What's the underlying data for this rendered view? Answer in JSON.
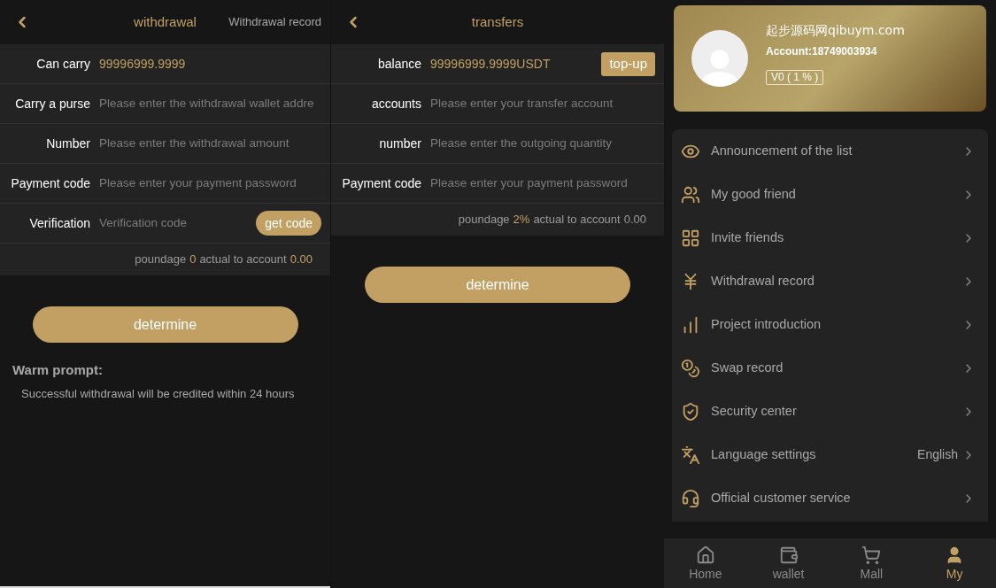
{
  "withdrawal": {
    "title": "withdrawal",
    "link": "Withdrawal record",
    "rows": [
      {
        "kind": "value",
        "label": "Can carry",
        "value": "99996999.9999"
      },
      {
        "kind": "input",
        "label": "Carry a purse",
        "placeholder": "Please enter the withdrawal wallet addre"
      },
      {
        "kind": "input",
        "label": "Number",
        "placeholder": "Please enter the withdrawal amount"
      },
      {
        "kind": "input",
        "label": "Payment code",
        "placeholder": "Please enter your payment password"
      },
      {
        "kind": "code",
        "label": "Verification",
        "placeholder": "Verification code",
        "button": "get code"
      }
    ],
    "fee": [
      {
        "text": "poundage",
        "highlight": false
      },
      {
        "text": "0",
        "highlight": true
      },
      {
        "text": "actual to account",
        "highlight": false
      },
      {
        "text": "0.00",
        "highlight": true
      }
    ],
    "submit": "determine",
    "prompt_title": "Warm prompt:",
    "prompt_text": "Successful withdrawal will be credited within 24 hours"
  },
  "transfer": {
    "title": "transfers",
    "rows": [
      {
        "kind": "value",
        "label": "balance",
        "value": "99996999.9999USDT",
        "button": "top-up"
      },
      {
        "kind": "input",
        "label": "accounts",
        "placeholder": "Please enter your transfer account"
      },
      {
        "kind": "input",
        "label": "number",
        "placeholder": "Please enter the outgoing quantity"
      },
      {
        "kind": "input",
        "label": "Payment code",
        "placeholder": "Please enter your payment password"
      }
    ],
    "fee": [
      {
        "text": "poundage",
        "highlight": false
      },
      {
        "text": "2%",
        "highlight": true
      },
      {
        "text": "actual to account",
        "highlight": false
      },
      {
        "text": "0.00",
        "highlight": false
      }
    ],
    "submit": "determine"
  },
  "profile": {
    "name": "起步源码网qibuym.com",
    "account": "Account:18749003934",
    "level": "V0 ( 1 % )"
  },
  "menu": [
    {
      "kind": "eye",
      "label": "Announcement of the list"
    },
    {
      "kind": "friends",
      "label": "My good friend"
    },
    {
      "kind": "grid",
      "label": "Invite friends"
    },
    {
      "kind": "yen",
      "label": "Withdrawal record"
    },
    {
      "kind": "chart",
      "label": "Project introduction"
    },
    {
      "kind": "coins",
      "label": "Swap record"
    },
    {
      "kind": "shield",
      "label": "Security center"
    },
    {
      "kind": "language",
      "label": "Language settings",
      "value": "English"
    },
    {
      "kind": "headset",
      "label": "Official customer service"
    }
  ],
  "tabbar": [
    {
      "kind": "home",
      "label": "Home",
      "selected": false
    },
    {
      "kind": "wallet",
      "label": "wallet",
      "selected": false
    },
    {
      "kind": "cart",
      "label": "Mall",
      "selected": false
    },
    {
      "kind": "user",
      "label": "My",
      "selected": true
    }
  ]
}
